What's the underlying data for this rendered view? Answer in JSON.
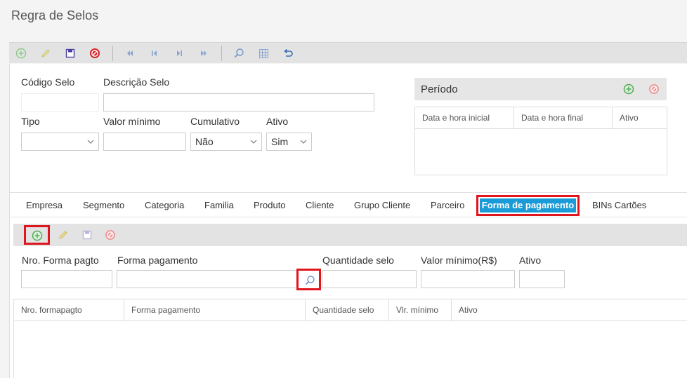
{
  "page": {
    "title": "Regra de Selos"
  },
  "toolbar": {
    "icons": [
      "add-icon",
      "edit-icon",
      "save-icon",
      "cancel-icon",
      "first-icon",
      "previous-icon",
      "next-icon",
      "last-icon",
      "search-icon",
      "grid-icon",
      "undo-icon"
    ]
  },
  "form": {
    "codigo_label": "Código Selo",
    "descricao_label": "Descrição Selo",
    "tipo_label": "Tipo",
    "tipo_value": "",
    "valor_minimo_label": "Valor mínimo",
    "cumulativo_label": "Cumulativo",
    "cumulativo_value": "Não",
    "ativo_label": "Ativo",
    "ativo_value": "Sim"
  },
  "periodo": {
    "title": "Período",
    "columns": [
      "Data e hora inicial",
      "Data e hora final",
      "Ativo"
    ]
  },
  "tabs": {
    "items": [
      "Empresa",
      "Segmento",
      "Categoria",
      "Familia",
      "Produto",
      "Cliente",
      "Grupo Cliente",
      "Parceiro",
      "Forma de pagamento",
      "BINs Cartões"
    ],
    "active": "Forma de pagamento"
  },
  "pagamento": {
    "nro_label": "Nro. Forma pagto",
    "forma_label": "Forma pagamento",
    "quantidade_label": "Quantidade selo",
    "valor_label": "Valor mínimo(R$)",
    "ativo_label": "Ativo",
    "columns": [
      "Nro. formapagto",
      "Forma pagamento",
      "Quantidade selo",
      "Vlr. mínimo",
      "Ativo"
    ]
  },
  "colors": {
    "accent": "#1a9ad6",
    "highlight": "#e0161e",
    "add": "#4caf50",
    "cancel": "#d9232a"
  }
}
